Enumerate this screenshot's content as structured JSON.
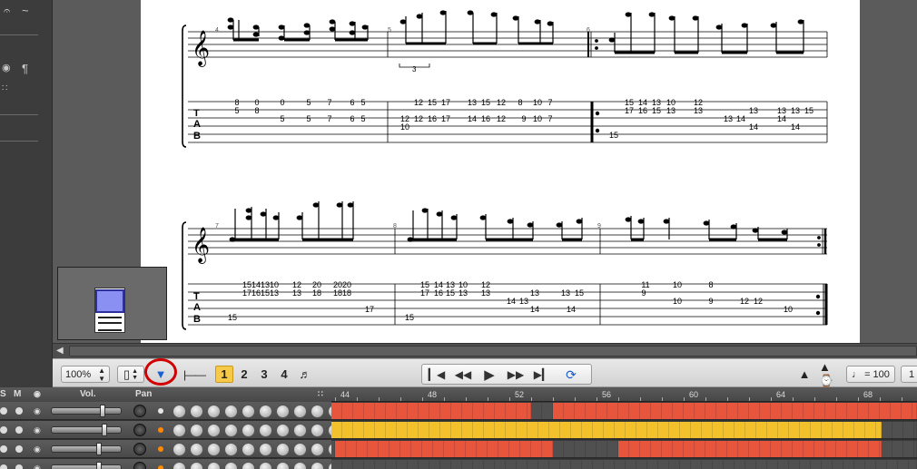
{
  "left_panel": {
    "symbols": [
      "𝄐",
      "~",
      "🔒",
      "¶",
      "⁂"
    ]
  },
  "score": {
    "system1": {
      "measure_numbers": [
        "4",
        "5",
        "6"
      ],
      "tuplet": "3",
      "tab_letters": [
        "T",
        "A",
        "B"
      ],
      "tab_numbers": [
        {
          "t": "8"
        },
        {
          "t": "0"
        },
        {
          "t": "0"
        },
        {
          "t": "5"
        },
        {
          "t": "7"
        },
        {
          "t": "6"
        },
        {
          "t": "5"
        },
        {
          "t": "5"
        },
        {
          "t": "8"
        },
        {
          "t": "5"
        },
        {
          "t": "5"
        },
        {
          "t": "7"
        },
        {
          "t": "6"
        },
        {
          "t": "5"
        },
        {
          "t": "12"
        },
        {
          "t": "15"
        },
        {
          "t": "17"
        },
        {
          "t": "13"
        },
        {
          "t": "15"
        },
        {
          "t": "12"
        },
        {
          "t": "8"
        },
        {
          "t": "10"
        },
        {
          "t": "7"
        },
        {
          "t": "12"
        },
        {
          "t": "12"
        },
        {
          "t": "16"
        },
        {
          "t": "17"
        },
        {
          "t": "14"
        },
        {
          "t": "16"
        },
        {
          "t": "12"
        },
        {
          "t": "9"
        },
        {
          "t": "10"
        },
        {
          "t": "7"
        },
        {
          "t": "10"
        },
        {
          "t": "15"
        },
        {
          "t": "14"
        },
        {
          "t": "13"
        },
        {
          "t": "10"
        },
        {
          "t": "12"
        },
        {
          "t": "17"
        },
        {
          "t": "16"
        },
        {
          "t": "15"
        },
        {
          "t": "13"
        },
        {
          "t": "13"
        },
        {
          "t": "13"
        },
        {
          "t": "13"
        },
        {
          "t": "14"
        },
        {
          "t": "13"
        },
        {
          "t": "14"
        },
        {
          "t": "13"
        },
        {
          "t": "15"
        },
        {
          "t": "14"
        },
        {
          "t": "14"
        },
        {
          "t": "15"
        }
      ]
    },
    "system2": {
      "measure_numbers": [
        "7",
        "8",
        "9"
      ],
      "tab_letters": [
        "T",
        "A",
        "B"
      ],
      "tab_numbers": [
        {
          "t": "15141310"
        },
        {
          "t": "12"
        },
        {
          "t": "20"
        },
        {
          "t": "2020"
        },
        {
          "t": "17161513"
        },
        {
          "t": "13"
        },
        {
          "t": "18"
        },
        {
          "t": "1818"
        },
        {
          "t": "17"
        },
        {
          "t": "15"
        },
        {
          "t": "15"
        },
        {
          "t": "14"
        },
        {
          "t": "13"
        },
        {
          "t": "10"
        },
        {
          "t": "12"
        },
        {
          "t": "17"
        },
        {
          "t": "16"
        },
        {
          "t": "15"
        },
        {
          "t": "13"
        },
        {
          "t": "13"
        },
        {
          "t": "13"
        },
        {
          "t": "14"
        },
        {
          "t": "13"
        },
        {
          "t": "13"
        },
        {
          "t": "15"
        },
        {
          "t": "14"
        },
        {
          "t": "14"
        },
        {
          "t": "15"
        },
        {
          "t": "11"
        },
        {
          "t": "10"
        },
        {
          "t": "8"
        },
        {
          "t": "9"
        },
        {
          "t": "10"
        },
        {
          "t": "9"
        },
        {
          "t": "12"
        },
        {
          "t": "12"
        },
        {
          "t": "10"
        }
      ]
    }
  },
  "toolbar": {
    "zoom": "100%",
    "layout_icon": "page-layout-icon",
    "voices": [
      "1",
      "2",
      "3",
      "4"
    ],
    "active_voice": "1",
    "tempo_label": "= 100",
    "tempo_next": "1"
  },
  "tracks": {
    "header": {
      "s": "S",
      "m": "M",
      "vol": "Vol.",
      "pan": "Pan"
    },
    "bars": [
      "44",
      "48",
      "52",
      "56",
      "60",
      "64",
      "68"
    ],
    "colors": {
      "red": "#e8553d",
      "yellow": "#f2c12c",
      "empty": "#505050"
    }
  }
}
